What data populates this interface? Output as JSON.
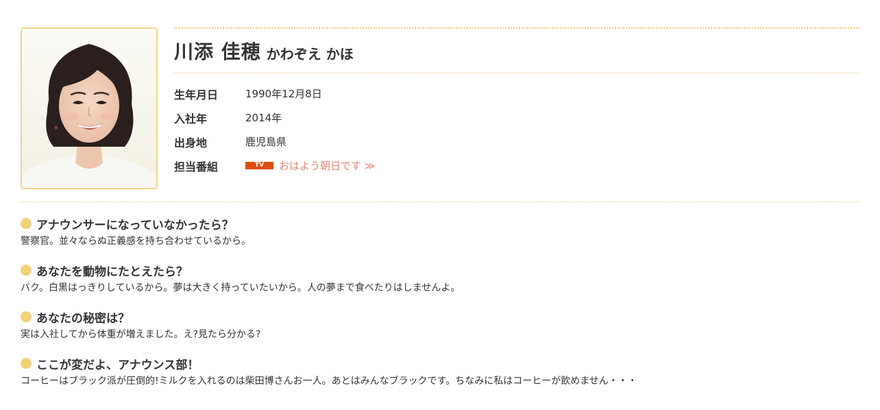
{
  "profile": {
    "name": "川添 佳穂",
    "name_kana": "かわぞえ かほ",
    "photo_icon": "announcer-portrait-image",
    "facts": [
      {
        "label": "生年月日",
        "value": "1990年12月8日"
      },
      {
        "label": "入社年",
        "value": "2014年"
      },
      {
        "label": "出身地",
        "value": "鹿児島県"
      }
    ],
    "program": {
      "label": "担当番組",
      "badge": "TV",
      "link_text": "おはよう朝日です ≫"
    }
  },
  "qa": [
    {
      "question": "アナウンサーになっていなかったら？",
      "answer": "警察官。並々ならぬ正義感を持ち合わせているから。"
    },
    {
      "question": "あなたを動物にたとえたら？",
      "answer": "バク。白黒はっきりしているから。夢は大きく持っていたいから。人の夢まで食べたりはしませんよ。"
    },
    {
      "question": "あなたの秘密は？",
      "answer": "実は入社してから体重が増えました。え?見たら分かる?"
    },
    {
      "question": "ここが変だよ、アナウンス部！",
      "answer": "コーヒーはブラック派が圧倒的!ミルクを入れるのは柴田博さんお一人。あとはみんなブラックです。ちなみに私はコーヒーが飲めません・・・"
    }
  ],
  "colors": {
    "accent_gold": "#f1d27a",
    "badge_orange": "#de4d12",
    "link_salmon": "#e08a76",
    "text": "#333333"
  }
}
